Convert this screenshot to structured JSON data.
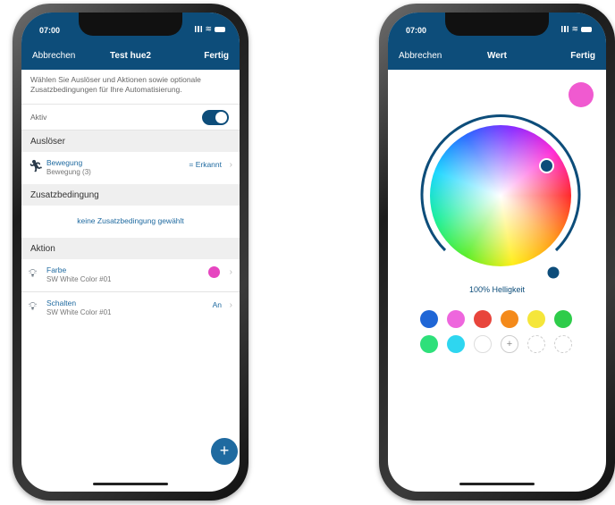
{
  "left": {
    "status": {
      "time": "07:00"
    },
    "nav": {
      "cancel": "Abbrechen",
      "title": "Test hue2",
      "done": "Fertig"
    },
    "intro": "Wählen Sie Auslöser und Aktionen sowie optionale Zusatzbedingungen für Ihre Automatisierung.",
    "active": {
      "label": "Aktiv",
      "value": true
    },
    "sections": {
      "trigger": "Auslöser",
      "condition": "Zusatzbedingung",
      "action": "Aktion"
    },
    "trigger_item": {
      "title": "Bewegung",
      "subtitle": "Bewegung (3)",
      "value": "= Erkannt"
    },
    "condition_empty": "keine Zusatzbedingung gewählt",
    "actions": [
      {
        "title": "Farbe",
        "subtitle": "SW White Color #01",
        "value": ""
      },
      {
        "title": "Schalten",
        "subtitle": "SW White Color #01",
        "value": "An"
      }
    ],
    "fab_symbol": "+"
  },
  "right": {
    "status": {
      "time": "07:00"
    },
    "nav": {
      "cancel": "Abbrechen",
      "title": "Wert",
      "done": "Fertig"
    },
    "brightness_label": "100% Helligkeit",
    "selected_color": "#f05ad0",
    "swatches": [
      "#1f66d6",
      "#ee66dd",
      "#e8453c",
      "#f48a1a",
      "#f5e63a",
      "#2ecc4a",
      "#2ee07a",
      "#2ed6f0"
    ],
    "add_symbol": "+"
  },
  "colors": {
    "brand": "#0d4d7a",
    "link": "#1f6aa0",
    "section_bg": "#efefef"
  }
}
